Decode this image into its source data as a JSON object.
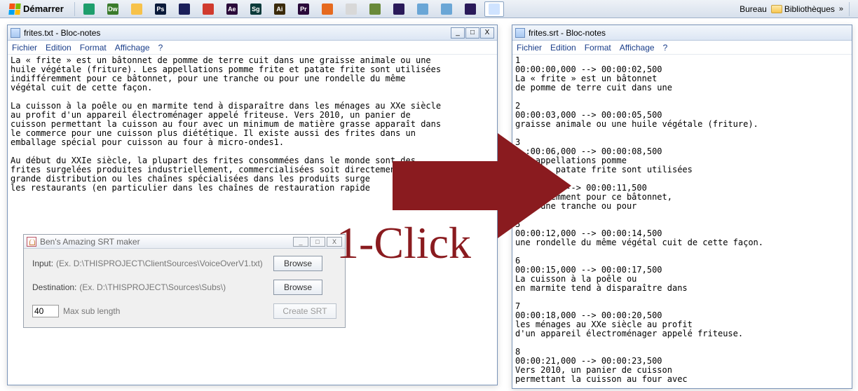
{
  "taskbar": {
    "start_label": "Démarrer",
    "icons": [
      {
        "name": "home-icon",
        "label": "",
        "bg": "#1e9e6c"
      },
      {
        "name": "dw-icon",
        "label": "Dw",
        "bg": "#3a7b2b"
      },
      {
        "name": "explorer-icon",
        "label": "",
        "bg": "#f7c24a"
      },
      {
        "name": "ps-icon",
        "label": "Ps",
        "bg": "#0a1a3a"
      },
      {
        "name": "app-icon-1",
        "label": "",
        "bg": "#1a1f5a"
      },
      {
        "name": "red-icon",
        "label": "",
        "bg": "#d03a2e"
      },
      {
        "name": "ae-icon",
        "label": "Ae",
        "bg": "#2a0a3a"
      },
      {
        "name": "sg-icon",
        "label": "Sg",
        "bg": "#0a3a3a"
      },
      {
        "name": "ai-icon",
        "label": "Ai",
        "bg": "#3a2a0a"
      },
      {
        "name": "pr-icon",
        "label": "Pr",
        "bg": "#2a0a3a"
      },
      {
        "name": "firefox-icon",
        "label": "",
        "bg": "#e66a1f"
      },
      {
        "name": "app-icon-2",
        "label": "",
        "bg": "#d8d8d8"
      },
      {
        "name": "minecraft-icon",
        "label": "",
        "bg": "#6a8a3a"
      },
      {
        "name": "eclipse-icon",
        "label": "",
        "bg": "#2a1a5a"
      },
      {
        "name": "cube-icon",
        "label": "",
        "bg": "#6aa6d6"
      },
      {
        "name": "cube2-icon",
        "label": "",
        "bg": "#6aa6d6"
      },
      {
        "name": "eclipse2-icon",
        "label": "",
        "bg": "#2a1a5a"
      },
      {
        "name": "notepad-task-icon",
        "label": "",
        "bg": "#cfe3ff",
        "active": true
      }
    ],
    "right": {
      "bureau": "Bureau",
      "biblio": "Bibliothèques",
      "chevron": "»"
    }
  },
  "left_window": {
    "title": "frites.txt - Bloc-notes",
    "minimize": "_",
    "maximize": "□",
    "close": "X",
    "menu": [
      "Fichier",
      "Edition",
      "Format",
      "Affichage",
      "?"
    ],
    "text": "La « frite » est un bâtonnet de pomme de terre cuit dans une graisse animale ou une\nhuile végétale (friture). Les appellations pomme frite et patate frite sont utilisées\nindifféremment pour ce bâtonnet, pour une tranche ou pour une rondelle du même\nvégétal cuit de cette façon.\n\nLa cuisson à la poêle ou en marmite tend à disparaître dans les ménages au XXe siècle\nau profit d'un appareil électroménager appelé friteuse. Vers 2010, un panier de\ncuisson permettant la cuisson au four avec un minimum de matière grasse apparaît dans\nle commerce pour une cuisson plus diététique. Il existe aussi des frites dans un\nemballage spécial pour cuisson au four à micro-ondes1.\n\nAu début du XXIe siècle, la plupart des frites consommées dans le monde sont des\nfrites surgelées produites industriellement, commercialisées soit directement dans la\ngrande distribution ou les chaînes spécialisées dans les produits surge\nles restaurants (en particulier dans les chaînes de restauration rapide"
  },
  "mini_app": {
    "title": "Ben's Amazing SRT maker",
    "input_label": "Input:",
    "input_hint": "(Ex. D:\\THISPROJECT\\ClientSources\\VoiceOverV1.txt)",
    "dest_label": "Destination:",
    "dest_hint": "(Ex. D:\\THISPROJECT\\Sources\\Subs\\)",
    "browse_label": "Browse",
    "maxsub_value": "40",
    "maxsub_label": "Max sub length",
    "create_label": "Create SRT",
    "min": "_",
    "max": "□",
    "close": "X"
  },
  "right_window": {
    "title": "frites.srt - Bloc-notes",
    "menu": [
      "Fichier",
      "Edition",
      "Format",
      "Affichage",
      "?"
    ],
    "text": "1\n00:00:00,000 --> 00:00:02,500\nLa « frite » est un bâtonnet\nde pomme de terre cuit dans une\n\n2\n00:00:03,000 --> 00:00:05,500\ngraisse animale ou une huile végétale (friture).\n\n3\n  :00:06,000 --> 00:00:08,500\n    appellations pomme\n        patate frite sont utilisées\n\n     ,000 --> 00:00:11,500\n     éremment pour ce bâtonnet,\n   r une tranche ou pour\n\n5\n00:00:12,000 --> 00:00:14,500\nune rondelle du même végétal cuit de cette façon.\n\n6\n00:00:15,000 --> 00:00:17,500\nLa cuisson à la poêle ou\nen marmite tend à disparaître dans\n\n7\n00:00:18,000 --> 00:00:20,500\nles ménages au XXe siècle au profit\nd'un appareil électroménager appelé friteuse.\n\n8\n00:00:21,000 --> 00:00:23,500\nVers 2010, un panier de cuisson\npermettant la cuisson au four avec"
  },
  "overlay": {
    "label": "1-Click"
  }
}
